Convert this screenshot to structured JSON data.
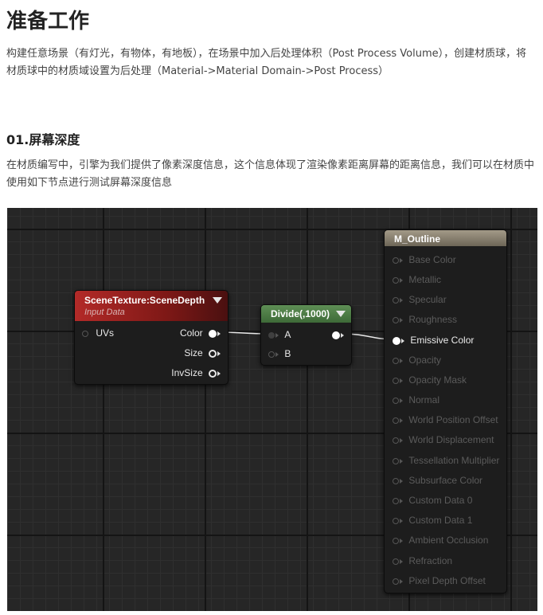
{
  "article": {
    "title": "准备工作",
    "intro": "构建任意场景（有灯光，有物体，有地板），在场景中加入后处理体积（Post Process Volume），创建材质球，将材质球中的材质域设置为后处理（Material->Material Domain->Post Process）",
    "section_title": "01.屏幕深度",
    "section_text": "在材质编写中，引擎为我们提供了像素深度信息，这个信息体现了渲染像素距离屏幕的距离信息，我们可以在材质中使用如下节点进行测试屏幕深度信息"
  },
  "graph": {
    "scene_texture_node": {
      "title": "SceneTexture:SceneDepth",
      "subtitle": "Input Data",
      "input_label": "UVs",
      "outputs": [
        "Color",
        "Size",
        "InvSize"
      ],
      "color": "#9a2220"
    },
    "divide_node": {
      "title": "Divide(,1000)",
      "inputs": [
        "A",
        "B"
      ],
      "color": "#4d7a46"
    },
    "material_node": {
      "title": "M_Outline",
      "active_pin": "Emissive Color",
      "pins": [
        "Base Color",
        "Metallic",
        "Specular",
        "Roughness",
        "Emissive Color",
        "Opacity",
        "Opacity Mask",
        "Normal",
        "World Position Offset",
        "World Displacement",
        "Tessellation Multiplier",
        "Subsurface Color",
        "Custom Data 0",
        "Custom Data 1",
        "Ambient Occlusion",
        "Refraction",
        "Pixel Depth Offset"
      ],
      "color": "#8a8372"
    }
  }
}
